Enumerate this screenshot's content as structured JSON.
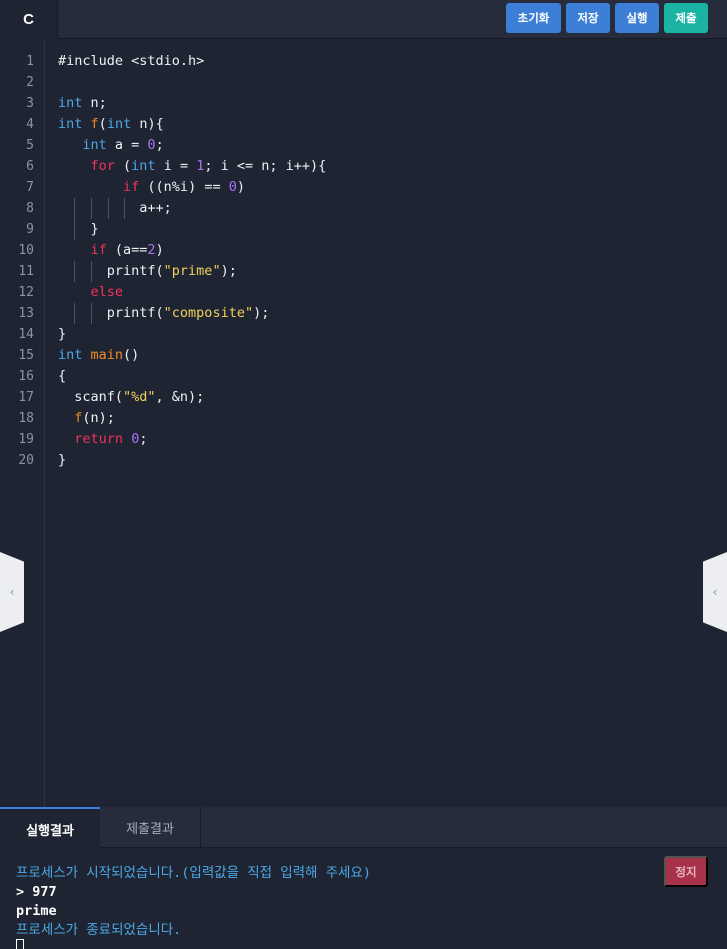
{
  "toolbar": {
    "language": "C",
    "reset_label": "초기화",
    "save_label": "저장",
    "run_label": "실행",
    "submit_label": "제출",
    "colors": {
      "primary": "#3d7fd6",
      "submit": "#1ab3a4",
      "stop": "#a8324a"
    }
  },
  "editor": {
    "line_numbers": [
      "1",
      "2",
      "3",
      "4",
      "5",
      "6",
      "7",
      "8",
      "9",
      "10",
      "11",
      "12",
      "13",
      "14",
      "15",
      "16",
      "17",
      "18",
      "19",
      "20"
    ],
    "code_lines": [
      "#include <stdio.h>",
      "",
      "int n;",
      "int f(int n){",
      "   int a = 0;",
      "    for (int i = 1; i <= n; i++){",
      "        if ((n%i) == 0)",
      "          a++;",
      "    }",
      "    if (a==2)",
      "      printf(\"prime\");",
      "    else",
      "      printf(\"composite\");",
      "}",
      "int main()",
      "{",
      "  scanf(\"%d\", &n);",
      "  f(n);",
      "  return 0;",
      "}"
    ]
  },
  "side_handles": {
    "left_icon": "chevron-left-icon",
    "right_icon": "chevron-left-icon",
    "glyph": "‹"
  },
  "bottom_panel": {
    "tabs": [
      {
        "label": "실행결과",
        "active": true
      },
      {
        "label": "제출결과",
        "active": false
      }
    ],
    "stop_label": "정지",
    "console_lines": [
      "프로세스가 시작되었습니다.(입력값을 직접 입력해 주세요)",
      "> 977",
      "prime",
      "프로세스가 종료되었습니다."
    ]
  }
}
